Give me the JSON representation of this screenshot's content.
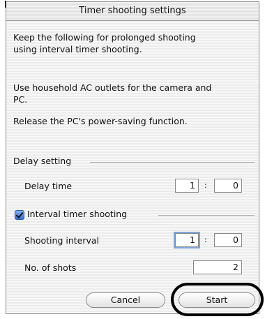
{
  "dialog": {
    "title": "Timer shooting settings",
    "note_line1": "Keep the following for prolonged shooting",
    "note_line2": "using interval timer shooting.",
    "ac_line1": "Use household AC outlets for the camera and",
    "ac_line2": "PC.",
    "power_saving": "Release the PC's power-saving function."
  },
  "delay": {
    "section_label": "Delay setting",
    "time_label": "Delay time",
    "minutes": "1",
    "seconds": "0",
    "separator": ":"
  },
  "interval": {
    "checkbox_label": "Interval timer shooting",
    "checked": true,
    "interval_label": "Shooting interval",
    "minutes": "1",
    "seconds": "0",
    "separator": ":",
    "shots_label": "No. of shots",
    "shots_value": "2"
  },
  "buttons": {
    "cancel": "Cancel",
    "start": "Start"
  }
}
